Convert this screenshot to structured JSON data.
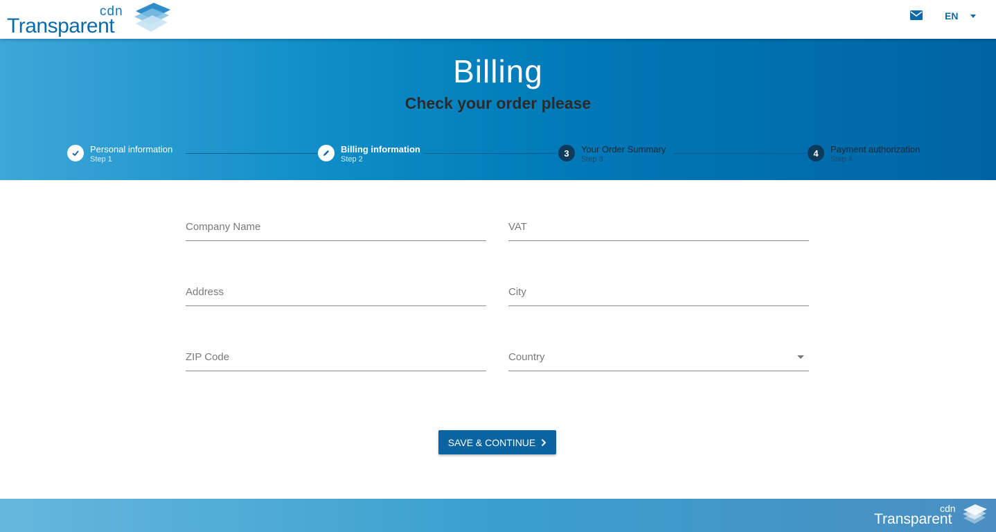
{
  "brand": {
    "logo_small": "cdn",
    "logo_word": "Transparent"
  },
  "header": {
    "mail_icon": "mail-icon",
    "language": "EN"
  },
  "hero": {
    "title": "Billing",
    "subtitle": "Check your order please",
    "steps": [
      {
        "label": "Personal information",
        "sub": "Step 1",
        "status": "done",
        "icon": "check-icon"
      },
      {
        "label": "Billing information",
        "sub": "Step 2",
        "status": "active",
        "icon": "pencil-icon"
      },
      {
        "label": "Your Order Summary",
        "sub": "Step 3",
        "status": "todo",
        "number": "3"
      },
      {
        "label": "Payment authorization",
        "sub": "Step 4",
        "status": "todo",
        "number": "4"
      }
    ]
  },
  "form": {
    "company_name": {
      "placeholder": "Company Name",
      "value": ""
    },
    "vat": {
      "placeholder": "VAT",
      "value": ""
    },
    "address": {
      "placeholder": "Address",
      "value": ""
    },
    "city": {
      "placeholder": "City",
      "value": ""
    },
    "zip": {
      "placeholder": "ZIP Code",
      "value": ""
    },
    "country": {
      "placeholder": "Country",
      "value": ""
    }
  },
  "actions": {
    "save_continue": "SAVE & CONTINUE"
  },
  "colors": {
    "primary": "#0a64a2",
    "hero_start": "#3ea6d8",
    "hero_end": "#0064a4",
    "step_dark": "#0d3b5c"
  }
}
